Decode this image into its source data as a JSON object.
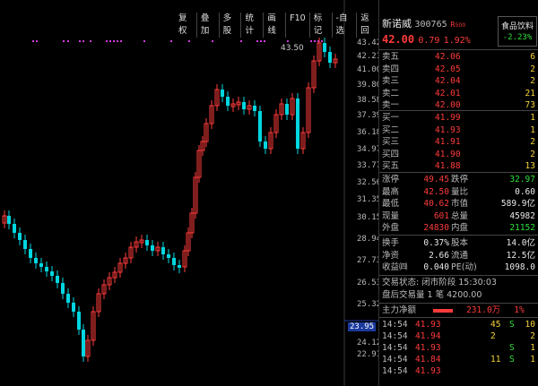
{
  "toolbar": {
    "buttons": [
      "复权",
      "叠加",
      "多股",
      "统计",
      "画线",
      "F10",
      "标记",
      "-自选",
      "返回"
    ]
  },
  "chart": {
    "price_labels": [
      "43.42",
      "42.21",
      "41.00",
      "39.80",
      "38.58",
      "37.39",
      "36.18",
      "34.97",
      "33.77",
      "32.56",
      "31.35",
      "30.15",
      "28.94",
      "27.73",
      "26.53",
      "25.32",
      "24.12",
      "22.91"
    ],
    "current_price_label": "23.95",
    "high_annotation": "43.50",
    "candle_colors": {
      "up": "#ff3b3b",
      "down": "#00d6e0"
    }
  },
  "stock": {
    "name": "新诺威",
    "code": "300765",
    "tag": "R",
    "badge": "500",
    "price": "42.00",
    "change": "0.79",
    "change_pct": "1.92%",
    "sector": "食品饮料",
    "sector_pct": "-2.23%"
  },
  "asks": [
    {
      "label": "卖五",
      "price": "42.06",
      "vol": "6"
    },
    {
      "label": "卖四",
      "price": "42.05",
      "vol": "2"
    },
    {
      "label": "卖三",
      "price": "42.04",
      "vol": "2"
    },
    {
      "label": "卖二",
      "price": "42.01",
      "vol": "21"
    },
    {
      "label": "卖一",
      "price": "42.00",
      "vol": "73"
    }
  ],
  "bids": [
    {
      "label": "买一",
      "price": "41.99",
      "vol": "1"
    },
    {
      "label": "买二",
      "price": "41.93",
      "vol": "1"
    },
    {
      "label": "买三",
      "price": "41.91",
      "vol": "2"
    },
    {
      "label": "买四",
      "price": "41.90",
      "vol": "2"
    },
    {
      "label": "买五",
      "price": "41.88",
      "vol": "13"
    }
  ],
  "stats": [
    {
      "l1": "涨停",
      "v1": "49.45",
      "c1": "red",
      "l2": "跌停",
      "v2": "32.97",
      "c2": "green"
    },
    {
      "l1": "最高",
      "v1": "42.50",
      "c1": "red",
      "l2": "量比",
      "v2": "0.60",
      "c2": "white"
    },
    {
      "l1": "最低",
      "v1": "40.62",
      "c1": "red",
      "l2": "市值",
      "v2": "589.9亿",
      "c2": "white"
    },
    {
      "l1": "现量",
      "v1": "601",
      "c1": "red",
      "l2": "总量",
      "v2": "45982",
      "c2": "white"
    },
    {
      "l1": "外盘",
      "v1": "24830",
      "c1": "red",
      "l2": "内盘",
      "v2": "21152",
      "c2": "green"
    }
  ],
  "stats2": [
    {
      "l1": "换手",
      "v1": "0.37%",
      "l2": "股本",
      "v2": "14.0亿"
    },
    {
      "l1": "净资",
      "v1": "2.66",
      "l2": "流通",
      "v2": "12.5亿"
    },
    {
      "l1": "收益㈣",
      "v1": "0.040",
      "l2": "PE(动)",
      "v2": "1098.0"
    }
  ],
  "status": {
    "trade_state": "交易状态: 闭市阶段 15:30:03",
    "after_hours": "盘后交易量 1 笔 4200.00",
    "main_flow_label": "主力净额",
    "main_flow_value": "231.0万",
    "main_flow_pct": "1%"
  },
  "ticks": [
    {
      "time": "14:54",
      "price": "41.93",
      "vol": "45",
      "flag": "S",
      "n": "10"
    },
    {
      "time": "14:54",
      "price": "41.94",
      "vol": "2",
      "flag": "",
      "n": "2"
    },
    {
      "time": "14:54",
      "price": "41.93",
      "vol": "",
      "flag": "S",
      "n": "1"
    },
    {
      "time": "14:54",
      "price": "41.84",
      "vol": "11",
      "flag": "S",
      "n": "1"
    },
    {
      "time": "14:54",
      "price": "41.93",
      "vol": "",
      "flag": "",
      "n": ""
    }
  ]
}
